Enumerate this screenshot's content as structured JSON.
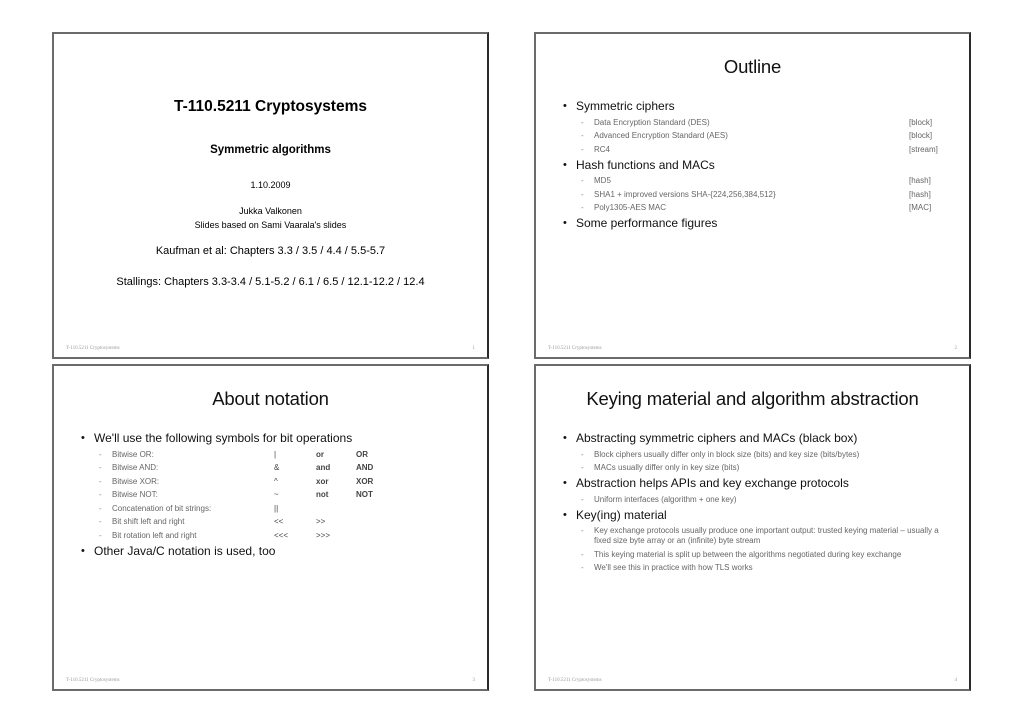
{
  "footer_course": "T-110.5211 Cryptosystems",
  "slides": [
    {
      "page": "1",
      "title": "T-110.5211 Cryptosystems",
      "subtitle": "Symmetric algorithms",
      "date": "1.10.2009",
      "author": "Jukka Valkonen",
      "based_on": "Slides based on Sami Vaarala's slides",
      "kaufman": "Kaufman et al:  Chapters 3.3  /  3.5  /  4.4  /  5.5-5.7",
      "stallings": "Stallings:  Chapters 3.3-3.4  /  5.1-5.2  /  6.1  /  6.5  /  12.1-12.2  / 12.4"
    },
    {
      "page": "2",
      "title": "Outline",
      "bullets": [
        {
          "text": "Symmetric ciphers",
          "subs": [
            {
              "text": "Data Encryption Standard (DES)",
              "tag": "[block]"
            },
            {
              "text": "Advanced Encryption Standard (AES)",
              "tag": "[block]"
            },
            {
              "text": "RC4",
              "tag": "[stream]"
            }
          ]
        },
        {
          "text": "Hash functions and MACs",
          "subs": [
            {
              "text": "MD5",
              "tag": "[hash]"
            },
            {
              "text": "SHA1  +  improved versions SHA-{224,256,384,512}",
              "tag": "[hash]"
            },
            {
              "text": "Poly1305-AES MAC",
              "tag": "[MAC]"
            }
          ]
        },
        {
          "text": "Some performance figures",
          "subs": []
        }
      ]
    },
    {
      "page": "3",
      "title": "About notation",
      "bullet1": "We'll use the following symbols for bit operations",
      "rows": [
        {
          "label": "Bitwise OR:",
          "sym": "|",
          "word": "or",
          "caps": "OR"
        },
        {
          "label": "Bitwise AND:",
          "sym": "&",
          "word": "and",
          "caps": "AND"
        },
        {
          "label": "Bitwise XOR:",
          "sym": "^",
          "word": "xor",
          "caps": "XOR"
        },
        {
          "label": "Bitwise NOT:",
          "sym": "~",
          "word": "not",
          "caps": "NOT"
        },
        {
          "label": "Concatenation of bit strings:",
          "sym": "||",
          "word": "",
          "caps": ""
        },
        {
          "label": "Bit shift left and right",
          "sym": "<<",
          "word": ">>",
          "caps": ""
        },
        {
          "label": "Bit rotation left and right",
          "sym": "<<<",
          "word": ">>>",
          "caps": ""
        }
      ],
      "bullet2": "Other Java/C notation is used, too"
    },
    {
      "page": "4",
      "title": "Keying material and algorithm abstraction",
      "bullets": [
        {
          "text": "Abstracting symmetric ciphers and MACs (black box)",
          "subs": [
            "Block ciphers usually differ only in block size (bits) and key size (bits/bytes)",
            "MACs usually differ only in key size (bits)"
          ]
        },
        {
          "text": "Abstraction helps APIs and key exchange protocols",
          "subs": [
            "Uniform interfaces (algorithm + one key)"
          ]
        },
        {
          "text": "Key(ing) material",
          "subs": [
            "Key exchange protocols usually produce one important output: trusted keying material – usually a fixed size byte array or an (infinite) byte stream",
            "This keying material is split up between the algorithms negotiated during key exchange",
            "We'll see this in practice with how TLS works"
          ]
        }
      ]
    }
  ]
}
